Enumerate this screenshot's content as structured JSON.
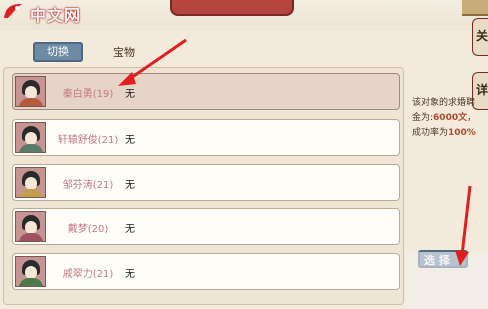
{
  "brand": {
    "site_name": "中文网",
    "logo_color": "#e02020"
  },
  "header": {
    "switch_label": "切换",
    "column_label": "宝物"
  },
  "side_tabs": [
    {
      "label": "关"
    },
    {
      "label": "详"
    }
  ],
  "list": {
    "rows": [
      {
        "name": "秦白勇(19)",
        "item": "无",
        "selected": true
      },
      {
        "name": "轩辕舒俊(21)",
        "item": "无",
        "selected": false
      },
      {
        "name": "邹芬涛(21)",
        "item": "无",
        "selected": false
      },
      {
        "name": "戴梦(20)",
        "item": "无",
        "selected": false
      },
      {
        "name": "戚翠力(21)",
        "item": "无",
        "selected": false
      }
    ]
  },
  "info": {
    "line1": "该对象的求婚聘",
    "line2_prefix": "金为:",
    "line2_value": "6000文",
    "line2_suffix": "，",
    "line3_prefix": "成功率为",
    "line3_value": "100%"
  },
  "select_button": {
    "label": "选 择"
  },
  "colors": {
    "accent_blue": "#6f8aa5",
    "name_pink": "#c07a80",
    "highlight": "#b04a34",
    "arrow_red": "#e02020"
  },
  "icons": [
    "app-logo-icon",
    "arrow-annotation-icon"
  ]
}
